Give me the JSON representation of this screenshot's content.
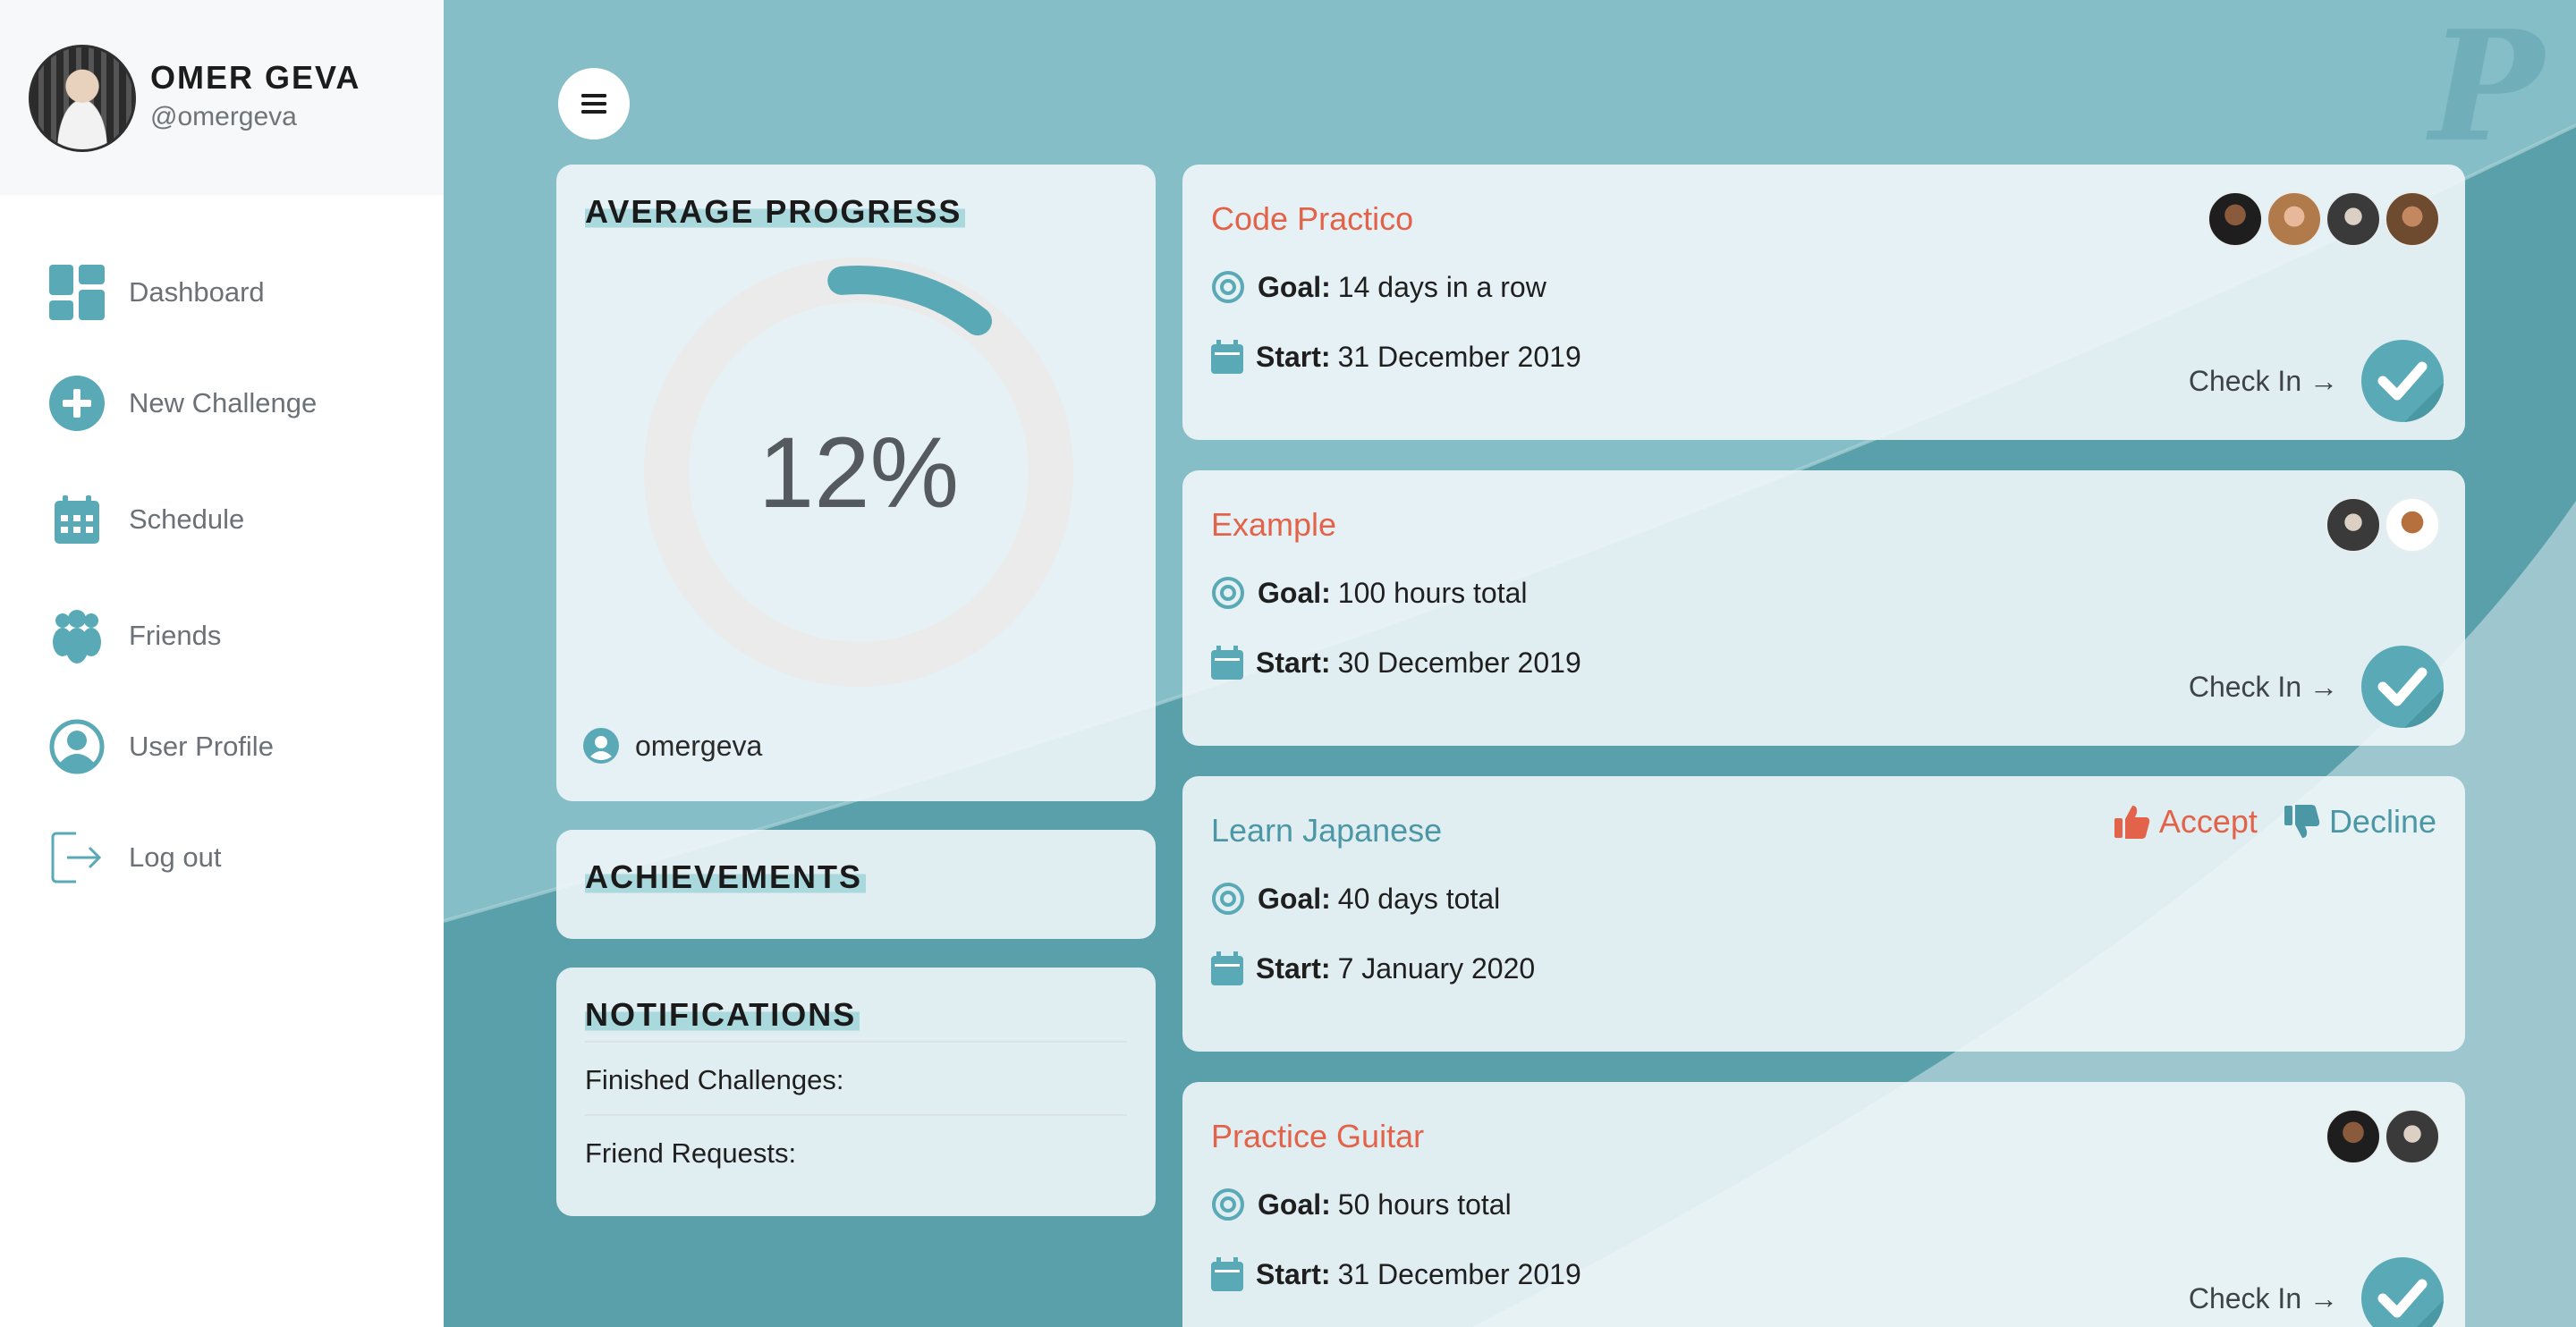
{
  "user": {
    "name": "OMER GEVA",
    "handle": "@omergeva"
  },
  "nav": [
    {
      "label": "Dashboard",
      "icon": "dashboard-icon"
    },
    {
      "label": "New Challenge",
      "icon": "plus-circle-icon"
    },
    {
      "label": "Schedule",
      "icon": "calendar-icon"
    },
    {
      "label": "Friends",
      "icon": "friends-icon"
    },
    {
      "label": "User Profile",
      "icon": "user-circle-icon"
    },
    {
      "label": "Log out",
      "icon": "logout-icon"
    }
  ],
  "progress": {
    "heading": "AVERAGE PROGRESS",
    "percent_label": "12%",
    "value": 0.12,
    "owner": "omergeva"
  },
  "achievements": {
    "heading": "ACHIEVEMENTS"
  },
  "notifications": {
    "heading": "NOTIFICATIONS",
    "finished_label": "Finished Challenges:",
    "friend_requests_label": "Friend Requests:"
  },
  "challenge_labels": {
    "goal": "Goal:",
    "start": "Start:",
    "check_in": "Check In →",
    "accept": "Accept",
    "decline": "Decline"
  },
  "challenges": [
    {
      "title": "Code Practico",
      "goal": "14 days in a row",
      "start": "31 December 2019",
      "status": "active",
      "members": [
        "member-avatar",
        "member-avatar",
        "member-avatar",
        "member-avatar"
      ]
    },
    {
      "title": "Example",
      "goal": "100 hours total",
      "start": "30 December 2019",
      "status": "active",
      "members": [
        "member-avatar",
        "member-avatar"
      ]
    },
    {
      "title": "Learn Japanese",
      "goal": "40 days total",
      "start": "7 January 2020",
      "status": "invite",
      "members": []
    },
    {
      "title": "Practice Guitar",
      "goal": "50 hours total",
      "start": "31 December 2019",
      "status": "active",
      "members": [
        "member-avatar",
        "member-avatar"
      ]
    }
  ],
  "colors": {
    "accent": "#5aa9b6",
    "title_red": "#e3634a",
    "pending_title": "#4c97a5",
    "background": "#85bec7"
  }
}
